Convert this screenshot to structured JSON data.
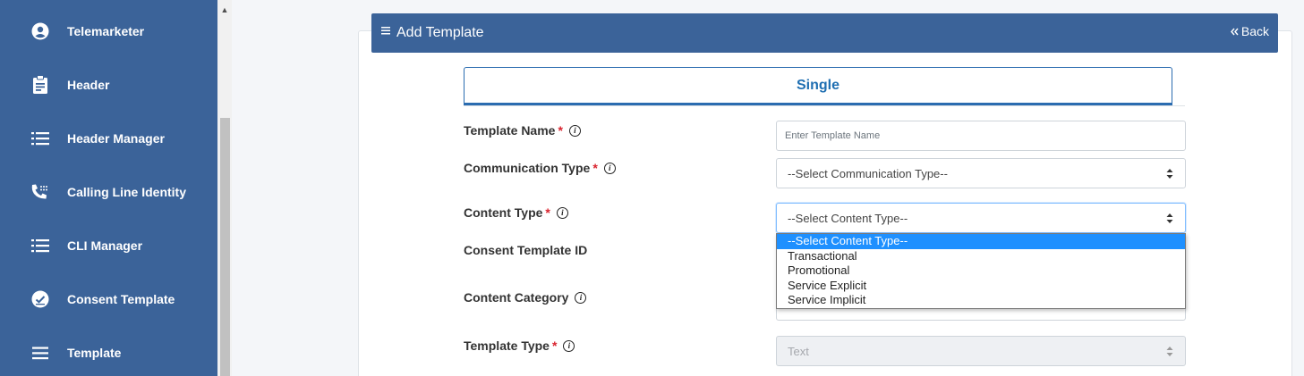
{
  "sidebar": {
    "items": [
      {
        "label": "Telemarketer",
        "icon": "user-circle-icon"
      },
      {
        "label": "Header",
        "icon": "clipboard-icon"
      },
      {
        "label": "Header Manager",
        "icon": "list-icon"
      },
      {
        "label": "Calling Line Identity",
        "icon": "phone-icon"
      },
      {
        "label": "CLI Manager",
        "icon": "list-icon"
      },
      {
        "label": "Consent Template",
        "icon": "check-circle-icon"
      },
      {
        "label": "Template",
        "icon": "bars-icon"
      }
    ]
  },
  "header": {
    "title": "Add Template",
    "back_label": "Back"
  },
  "tabs": {
    "single_label": "Single"
  },
  "form": {
    "template_name": {
      "label": "Template Name",
      "required": "*",
      "placeholder": "Enter Template Name"
    },
    "communication_type": {
      "label": "Communication Type",
      "required": "*",
      "value": "--Select Communication Type--"
    },
    "content_type": {
      "label": "Content Type",
      "required": "*",
      "value": "--Select Content Type--"
    },
    "consent_template_id": {
      "label": "Consent Template ID"
    },
    "content_category": {
      "label": "Content Category"
    },
    "template_type": {
      "label": "Template Type",
      "required": "*",
      "value": "Text"
    }
  },
  "dropdown": {
    "options": [
      "--Select Content Type--",
      "Transactional",
      "Promotional",
      "Service Explicit",
      "Service Implicit"
    ]
  },
  "colors": {
    "brand": "#3b6399",
    "tab_accent": "#1f6fb2",
    "required": "#d9232e",
    "selected_option": "#1e90ff"
  }
}
